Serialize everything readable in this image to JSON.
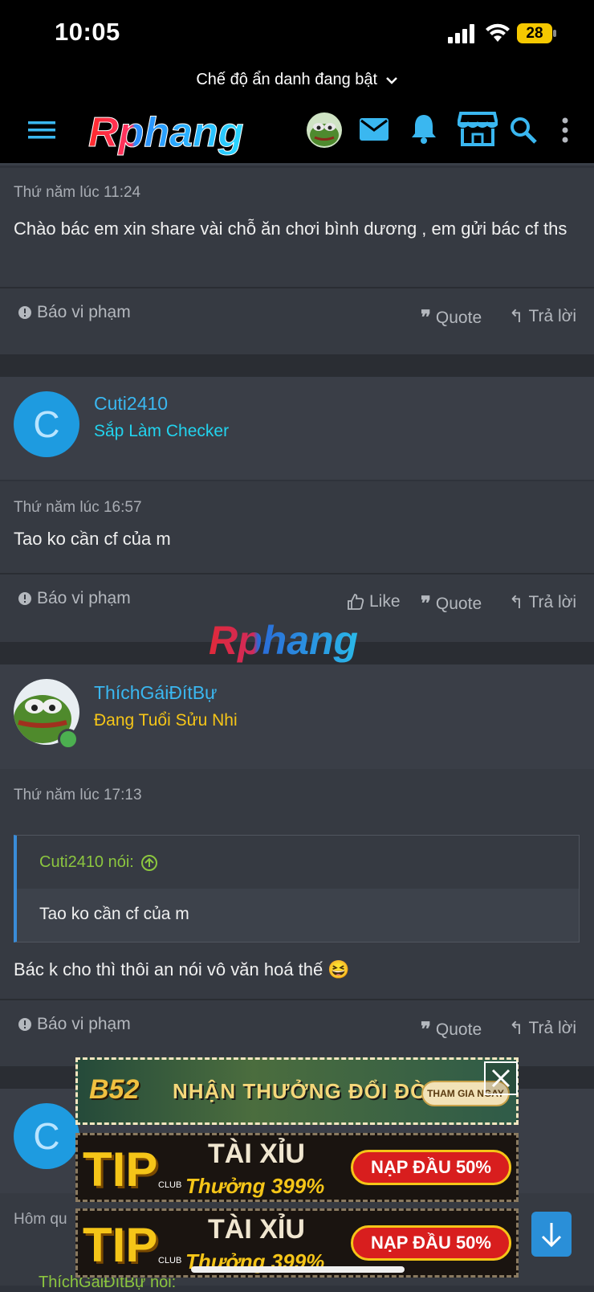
{
  "status": {
    "time": "10:05",
    "battery": "28"
  },
  "incognito": {
    "label": "Chế độ ẩn danh đang bật"
  },
  "nav": {
    "logo": "Rphang"
  },
  "posts": [
    {
      "timestamp": "Thứ năm lúc 11:24",
      "body": "Chào bác em xin share vài chỗ ăn chơi bình dương , em gửi bác cf ths",
      "report": "Báo vi phạm",
      "quote": "Quote",
      "reply": "Trả lời"
    },
    {
      "user": {
        "name": "Cuti2410",
        "title": "Sắp Làm Checker",
        "initial": "C",
        "title_color": "#22d3ee"
      },
      "timestamp": "Thứ năm lúc 16:57",
      "body": "Tao ko cần cf của m",
      "report": "Báo vi phạm",
      "like": "Like",
      "quote": "Quote",
      "reply": "Trả lời"
    },
    {
      "user": {
        "name": "ThíchGáiĐítBự",
        "title": "Đang Tuổi Sửu Nhi",
        "title_color": "#f5c518"
      },
      "timestamp": "Thứ năm lúc 17:13",
      "quote_block": {
        "author": "Cuti2410 nói:",
        "text": "Tao ko cần cf của m"
      },
      "body": "Bác k cho thì thôi an nói vô văn hoá thế 😆",
      "report": "Báo vi phạm",
      "quote": "Quote",
      "reply": "Trả lời"
    },
    {
      "user": {
        "initial": "C"
      },
      "timestamp": "Hôm qu",
      "quote_author": "ThíchGáiĐítBự nói:"
    }
  ],
  "ads": {
    "ad1": {
      "brand": "B52",
      "text": "NHẬN THƯỞNG ĐỔI ĐỜI",
      "cta": "THAM GIA NGAY"
    },
    "ad2": {
      "brand": "TIP",
      "club": "CLUB",
      "title": "TÀI XỈU",
      "bonus": "Thưởng 399%",
      "cta": "NẠP ĐẦU 50%"
    },
    "ad3": {
      "brand": "TIP",
      "club": "CLUB",
      "title": "TÀI XỈU",
      "bonus": "Thưởng 399%",
      "cta": "NẠP ĐẦU 50%"
    }
  },
  "watermark": "Rphang",
  "colors": {
    "accent": "#3ab7f0",
    "quote_author": "#8cc63f",
    "bg": "#2f333b"
  }
}
